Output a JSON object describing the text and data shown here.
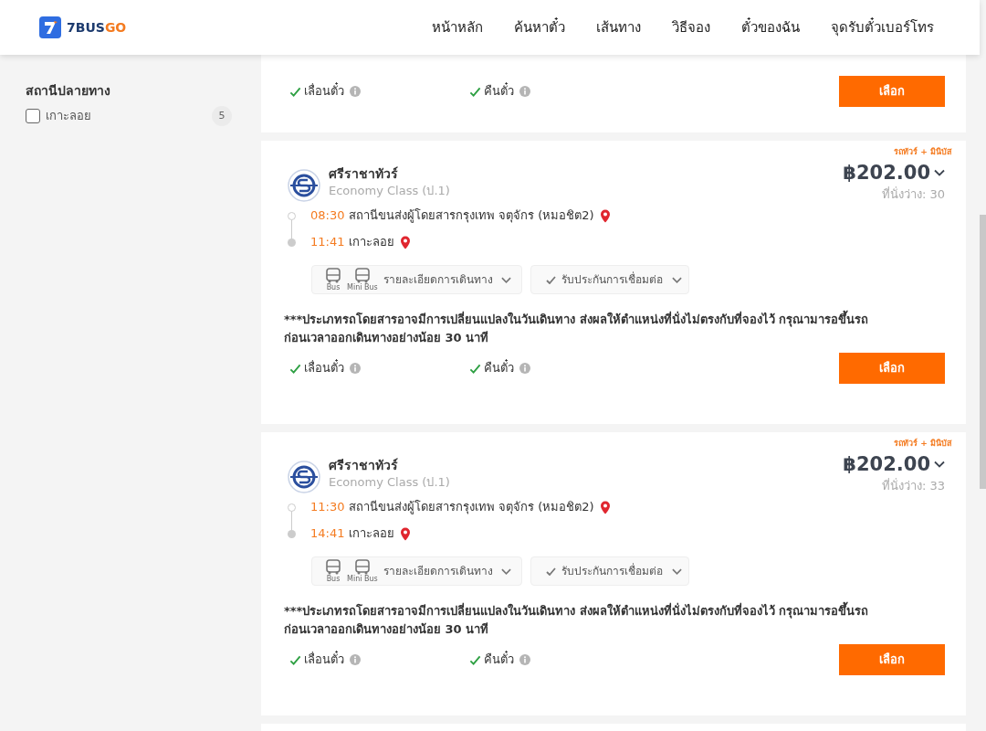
{
  "header": {
    "logo_text": "7BUS",
    "logo_accent": "GO",
    "nav": [
      {
        "label": "หน้าหลัก"
      },
      {
        "label": "ค้นหาตั๋ว"
      },
      {
        "label": "เส้นทาง"
      },
      {
        "label": "วิธีจอง"
      },
      {
        "label": "ตั๋วของฉัน"
      },
      {
        "label": "จุดรับตั๋วเบอร์โทร"
      }
    ]
  },
  "sidebar": {
    "section_title": "สถานีปลายทาง",
    "filters": [
      {
        "label": "เกาะลอย",
        "count": "5",
        "checked": false
      }
    ]
  },
  "cards": [
    {
      "kind": "partial",
      "features": [
        "เลื่อนตั๋ว",
        "คืนตั๋ว"
      ],
      "button": "เลือก"
    },
    {
      "kind": "full",
      "tag": "รถทัวร์ + มินิบัส",
      "operator": "ศรีราชาทัวร์",
      "class": "Economy Class (ป.1)",
      "price": "฿202.00",
      "seats": "ที่นั่งว่าง: 30",
      "stops": [
        {
          "time": "08:30",
          "place": "สถานีขนส่งผู้โดยสารกรุงเทพ จตุจักร (หมอชิต2)"
        },
        {
          "time": "11:41",
          "place": "เกาะลอย"
        }
      ],
      "vehicles": [
        "Bus",
        "Mini Bus"
      ],
      "details_label": "รายละเอียดการเดินทาง",
      "guarantee_label": "รับประกันการเชื่อมต่อ",
      "note_lines": [
        "***ประเภทรถโดยสารอาจมีการเปลี่ยนแปลงในวันเดินทาง ส่งผลให้ตำแหน่งที่นั่งไม่ตรงกับที่จองไว้ กรุณามารอขึ้นรถ",
        "ก่อนเวลาออกเดินทางอย่างน้อย 30 นาที"
      ],
      "features": [
        "เลื่อนตั๋ว",
        "คืนตั๋ว"
      ],
      "button": "เลือก"
    },
    {
      "kind": "full",
      "tag": "รถทัวร์ + มินิบัส",
      "operator": "ศรีราชาทัวร์",
      "class": "Economy Class (ป.1)",
      "price": "฿202.00",
      "seats": "ที่นั่งว่าง: 33",
      "stops": [
        {
          "time": "11:30",
          "place": "สถานีขนส่งผู้โดยสารกรุงเทพ จตุจักร (หมอชิต2)"
        },
        {
          "time": "14:41",
          "place": "เกาะลอย"
        }
      ],
      "vehicles": [
        "Bus",
        "Mini Bus"
      ],
      "details_label": "รายละเอียดการเดินทาง",
      "guarantee_label": "รับประกันการเชื่อมต่อ",
      "note_lines": [
        "***ประเภทรถโดยสารอาจมีการเปลี่ยนแปลงในวันเดินทาง ส่งผลให้ตำแหน่งที่นั่งไม่ตรงกับที่จองไว้ กรุณามารอขึ้นรถ",
        "ก่อนเวลาออกเดินทางอย่างน้อย 30 นาที"
      ],
      "features": [
        "เลื่อนตั๋ว",
        "คืนตั๋ว"
      ],
      "button": "เลือก"
    },
    {
      "kind": "edge"
    }
  ]
}
